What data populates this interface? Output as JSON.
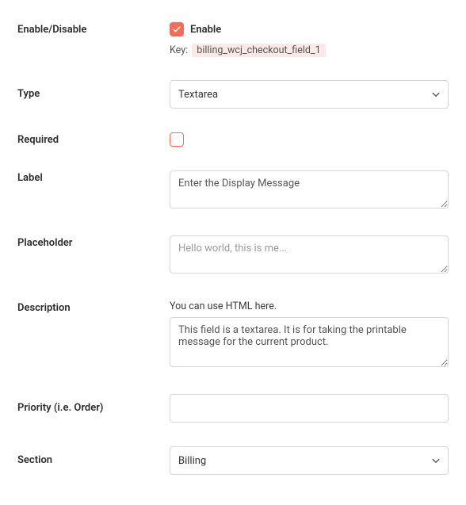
{
  "enable": {
    "label": "Enable/Disable",
    "checkbox_label": "Enable",
    "checked": true,
    "key_label": "Key:",
    "key_value": "billing_wcj_checkout_field_1"
  },
  "type": {
    "label": "Type",
    "value": "Textarea"
  },
  "required": {
    "label": "Required",
    "checked": false
  },
  "labelField": {
    "label": "Label",
    "value": "Enter the Display Message"
  },
  "placeholderField": {
    "label": "Placeholder",
    "value": "Hello world, this is me..."
  },
  "descriptionField": {
    "label": "Description",
    "hint": "You can use HTML here.",
    "value": "This field is a textarea. It is for taking the printable message for the current product."
  },
  "priorityField": {
    "label": "Priority (i.e. Order)",
    "value": ""
  },
  "sectionField": {
    "label": "Section",
    "value": "Billing"
  }
}
